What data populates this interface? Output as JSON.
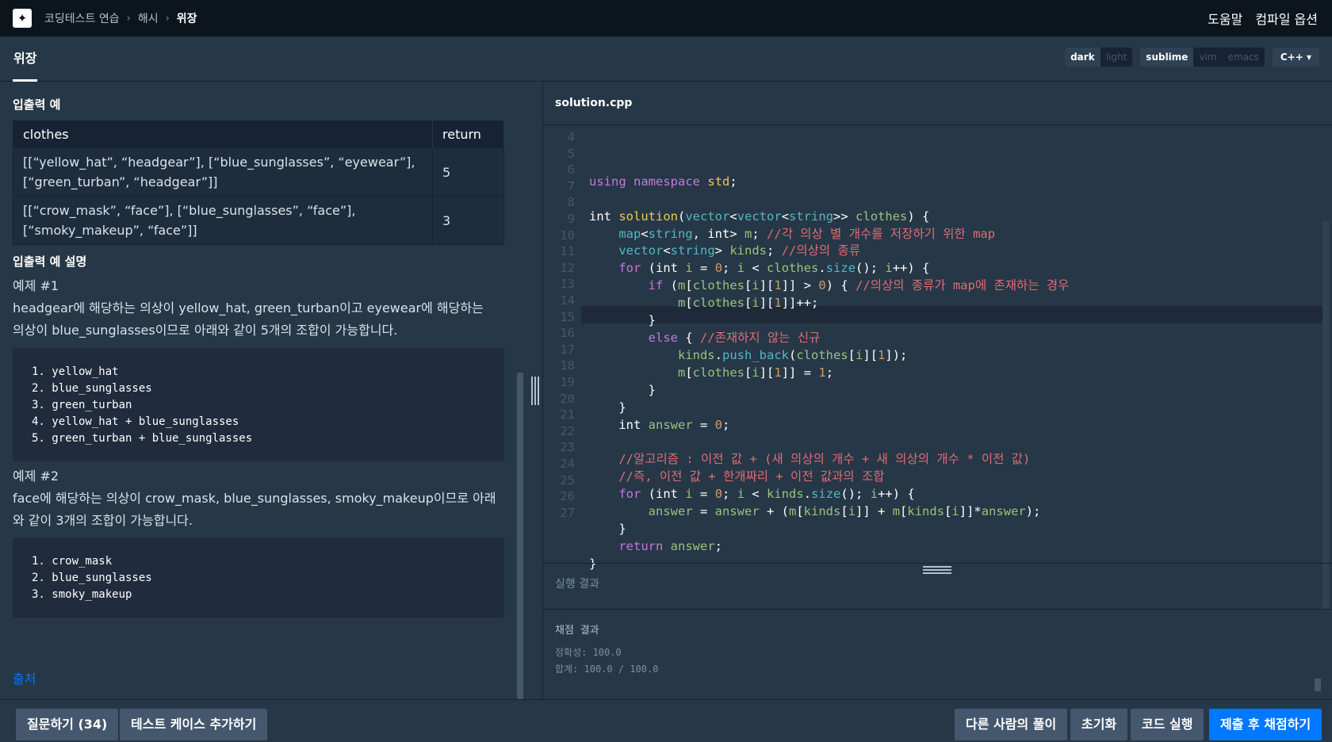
{
  "breadcrumb": {
    "item1": "코딩테스트 연습",
    "item2": "해시",
    "current": "위장",
    "sep": "›"
  },
  "top_links": {
    "help": "도움말",
    "compile_options": "컴파일 옵션"
  },
  "title_tab": "위장",
  "theme": {
    "dark": "dark",
    "light": "light"
  },
  "keymap": {
    "sublime": "sublime",
    "vim": "vim",
    "emacs": "emacs"
  },
  "language": "C++",
  "left": {
    "io_title": "입출력 예",
    "table": {
      "headers": [
        "clothes",
        "return"
      ],
      "rows": [
        {
          "clothes": "[[“yellow_hat”, “headgear”], [“blue_sunglasses”, “eyewear”], [“green_turban”, “headgear”]]",
          "ret": "5"
        },
        {
          "clothes": "[[“crow_mask”, “face”], [“blue_sunglasses”, “face”], [“smoky_makeup”, “face”]]",
          "ret": "3"
        }
      ]
    },
    "explain_title": "입출력 예 설명",
    "ex1_title": "예제 #1",
    "ex1_text": "headgear에 해당하는 의상이 yellow_hat, green_turban이고 eyewear에 해당하는 의상이 blue_sunglasses이므로 아래와 같이 5개의 조합이 가능합니다.",
    "ex1_list": [
      "1. yellow_hat",
      "2. blue_sunglasses",
      "3. green_turban",
      "4. yellow_hat + blue_sunglasses",
      "5. green_turban + blue_sunglasses"
    ],
    "ex2_title": "예제 #2",
    "ex2_text": "face에 해당하는 의상이 crow_mask, blue_sunglasses, smoky_makeup이므로 아래와 같이 3개의 조합이 가능합니다.",
    "ex2_list": [
      "1. crow_mask",
      "2. blue_sunglasses",
      "3. smoky_makeup"
    ],
    "source": "출처"
  },
  "editor": {
    "filename": "solution.cpp",
    "line_numbers": [
      "4",
      "5",
      "6",
      "7",
      "8",
      "9",
      "10",
      "11",
      "12",
      "13",
      "14",
      "15",
      "16",
      "17",
      "18",
      "19",
      "20",
      "21",
      "22",
      "23",
      "24",
      "25",
      "26",
      "27"
    ]
  },
  "result": {
    "header": "실행 결과",
    "title": "채점 결과",
    "accuracy": "정확성: 100.0",
    "total": "합계: 100.0 / 100.0"
  },
  "buttons": {
    "questions": "질문하기 (34)",
    "add_test": "테스트 케이스 추가하기",
    "others": "다른 사람의 풀이",
    "reset": "초기화",
    "run": "코드 실행",
    "submit": "제출 후 채점하기"
  }
}
